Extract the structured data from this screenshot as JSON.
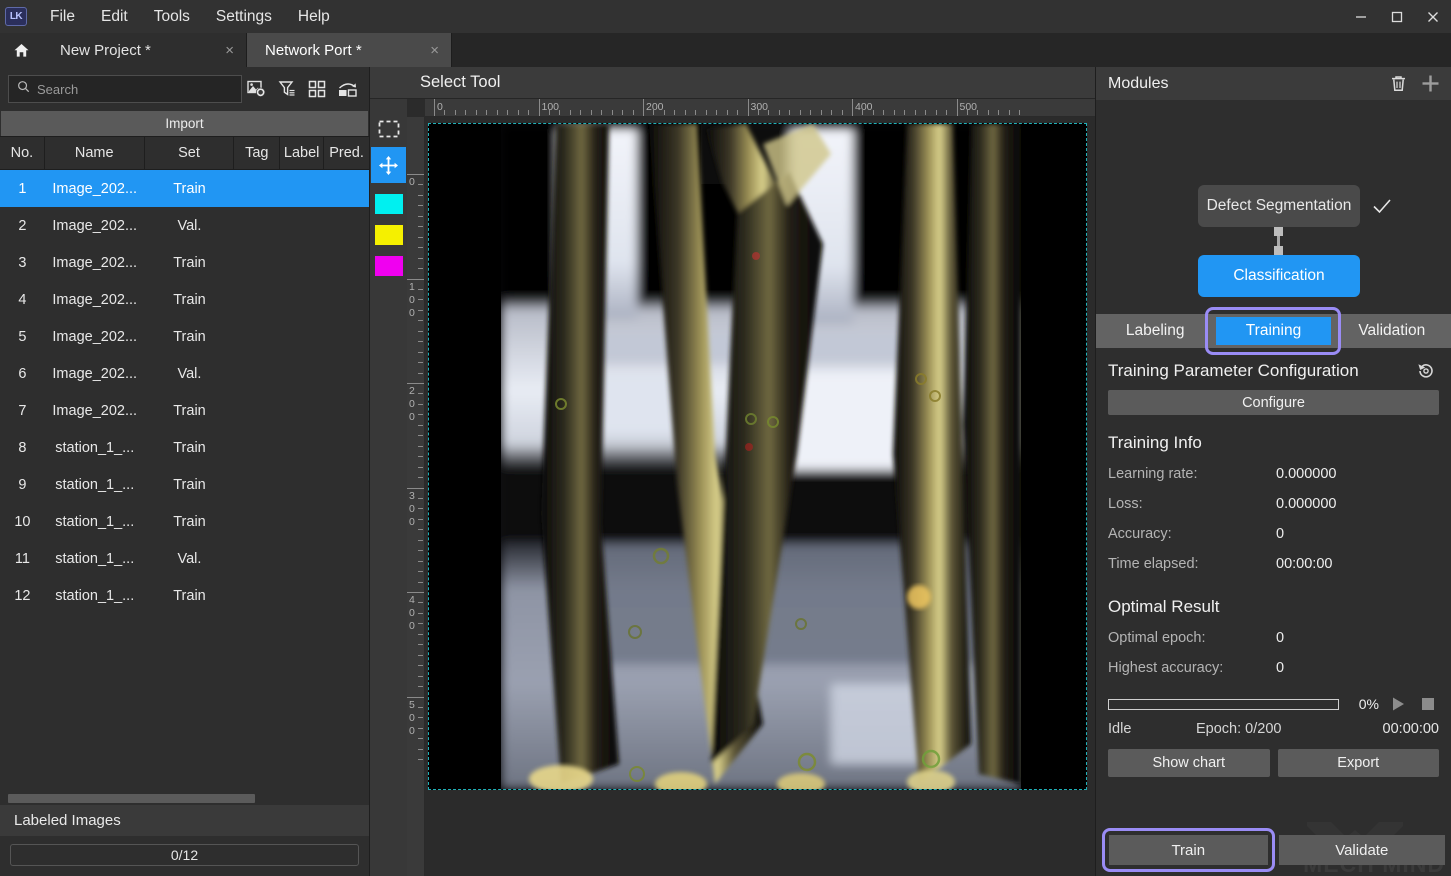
{
  "app": {
    "logo_text": "LK",
    "menus": [
      "File",
      "Edit",
      "Tools",
      "Settings",
      "Help"
    ],
    "window_controls": [
      "minimize-icon",
      "maximize-icon",
      "close-icon"
    ]
  },
  "tabs": {
    "home_icon": "home-icon",
    "items": [
      {
        "label": "New Project *",
        "close": "×",
        "active": false
      },
      {
        "label": "Network Port *",
        "close": "×",
        "active": true
      }
    ]
  },
  "left_panel": {
    "search": {
      "placeholder": "Search",
      "value": "",
      "icon": "search-icon"
    },
    "toolbar_icons": [
      "image-settings-icon",
      "filter-icon",
      "grid-view-icon",
      "compare-view-icon"
    ],
    "import_label": "Import",
    "columns": [
      "No.",
      "Name",
      "Set",
      "Tag",
      "Label",
      "Pred."
    ],
    "rows": [
      {
        "no": "1",
        "name": "Image_202...",
        "set": "Train",
        "tag": "",
        "label": "",
        "pred": ""
      },
      {
        "no": "2",
        "name": "Image_202...",
        "set": "Val.",
        "tag": "",
        "label": "",
        "pred": ""
      },
      {
        "no": "3",
        "name": "Image_202...",
        "set": "Train",
        "tag": "",
        "label": "",
        "pred": ""
      },
      {
        "no": "4",
        "name": "Image_202...",
        "set": "Train",
        "tag": "",
        "label": "",
        "pred": ""
      },
      {
        "no": "5",
        "name": "Image_202...",
        "set": "Train",
        "tag": "",
        "label": "",
        "pred": ""
      },
      {
        "no": "6",
        "name": "Image_202...",
        "set": "Val.",
        "tag": "",
        "label": "",
        "pred": ""
      },
      {
        "no": "7",
        "name": "Image_202...",
        "set": "Train",
        "tag": "",
        "label": "",
        "pred": ""
      },
      {
        "no": "8",
        "name": "station_1_...",
        "set": "Train",
        "tag": "",
        "label": "",
        "pred": ""
      },
      {
        "no": "9",
        "name": "station_1_...",
        "set": "Train",
        "tag": "",
        "label": "",
        "pred": ""
      },
      {
        "no": "10",
        "name": "station_1_...",
        "set": "Train",
        "tag": "",
        "label": "",
        "pred": ""
      },
      {
        "no": "11",
        "name": "station_1_...",
        "set": "Val.",
        "tag": "",
        "label": "",
        "pred": ""
      },
      {
        "no": "12",
        "name": "station_1_...",
        "set": "Train",
        "tag": "",
        "label": "",
        "pred": ""
      }
    ],
    "selected_row_index": 0,
    "labeled_images_title": "Labeled Images",
    "labeled_images_count": "0/12"
  },
  "center": {
    "tool_title": "Select Tool",
    "tools": [
      "marquee-select-icon",
      "move-icon"
    ],
    "active_tool": "move-icon",
    "swatches": [
      "#00f0f0",
      "#f5f000",
      "#f000f0"
    ],
    "ruler_h_labels": [
      "0",
      "100",
      "200",
      "300",
      "400",
      "500"
    ],
    "ruler_v_labels": [
      "0",
      "100",
      "200",
      "300",
      "400",
      "500"
    ],
    "selection_color": "#21b0b8"
  },
  "right_panel": {
    "header": {
      "title": "Modules",
      "icons": [
        "trash-icon",
        "plus-icon"
      ]
    },
    "graph": {
      "nodes": [
        {
          "label": "Defect Segmentation",
          "selected": false,
          "checked": true
        },
        {
          "label": "Classification",
          "selected": true,
          "checked": false
        }
      ]
    },
    "tabs": [
      {
        "label": "Labeling",
        "active": false
      },
      {
        "label": "Training",
        "active": true
      },
      {
        "label": "Validation",
        "active": false
      }
    ],
    "training_config": {
      "title": "Training Parameter Configuration",
      "reset_icon": "history-reset-icon",
      "configure_label": "Configure"
    },
    "training_info": {
      "title": "Training Info",
      "rows": [
        {
          "key": "Learning rate:",
          "value": "0.000000"
        },
        {
          "key": "Loss:",
          "value": "0.000000"
        },
        {
          "key": "Accuracy:",
          "value": "0"
        },
        {
          "key": "Time elapsed:",
          "value": "00:00:00"
        }
      ]
    },
    "optimal_result": {
      "title": "Optimal Result",
      "rows": [
        {
          "key": "Optimal epoch:",
          "value": "0"
        },
        {
          "key": "Highest accuracy:",
          "value": "0"
        }
      ]
    },
    "progress": {
      "percent_label": "0%",
      "percent_value": 0,
      "play_icon": "play-icon",
      "stop_icon": "stop-icon",
      "status": "Idle",
      "epoch": "Epoch: 0/200",
      "time": "00:00:00"
    },
    "actions": {
      "show_chart": "Show chart",
      "export": "Export"
    },
    "bottom": {
      "train": "Train",
      "validate": "Validate",
      "focused": "train"
    },
    "watermark": "MECH MIND"
  },
  "colors": {
    "accent_blue": "#2196f3",
    "focus_purple": "#9a8cf5",
    "panel_bg": "#2e2e2e",
    "header_bg": "#3b3b3b"
  }
}
